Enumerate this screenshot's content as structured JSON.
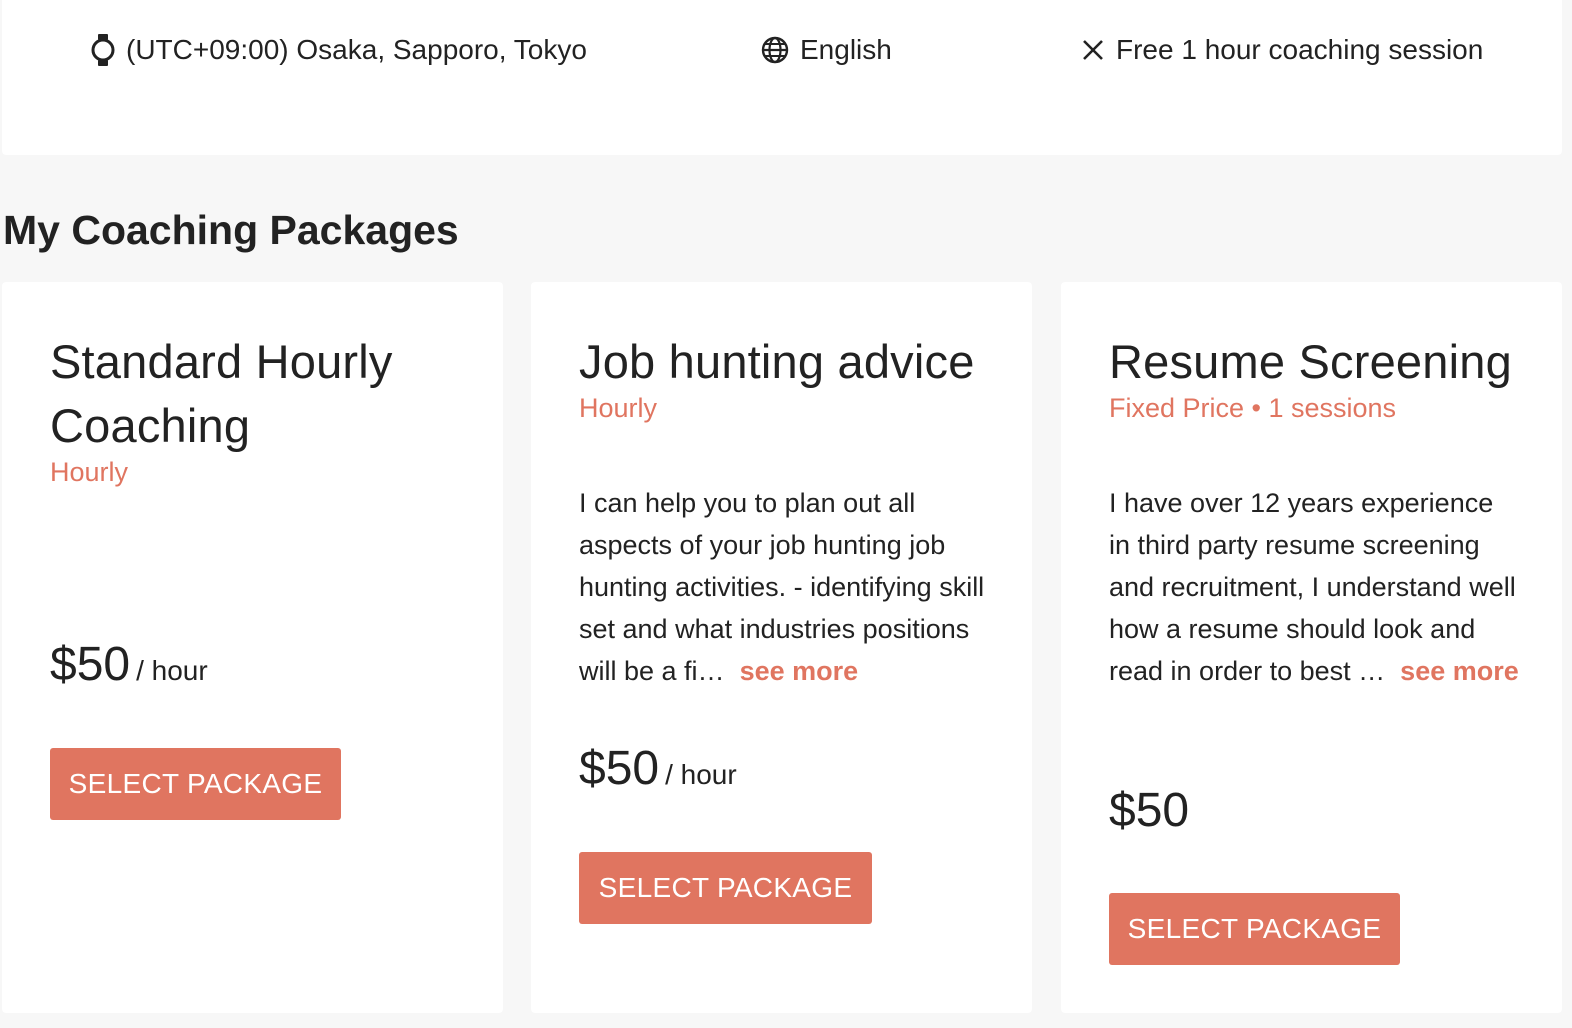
{
  "info_bar": {
    "timezone": "(UTC+09:00) Osaka, Sapporo, Tokyo",
    "timezone_icon": "watch-icon",
    "language": "English",
    "language_icon": "globe-icon",
    "free_session": "Free 1 hour coaching session",
    "free_session_icon": "close-icon"
  },
  "section": {
    "title": "My Coaching Packages"
  },
  "accent_color": "#e07560",
  "packages": [
    {
      "title": "Standard Hourly Coaching",
      "type": "Hourly",
      "description": "",
      "see_more": "",
      "price": "$50",
      "price_unit": "/ hour",
      "button": "SELECT PACKAGE"
    },
    {
      "title": "Job hunting advice",
      "type": "Hourly",
      "description": "I can help you to plan out all aspects of your job hunting job hunting activities. - identifying skill set and what industries positions will be a fi…",
      "see_more": "see more",
      "price": "$50",
      "price_unit": "/ hour",
      "button": "SELECT PACKAGE"
    },
    {
      "title": "Resume Screening",
      "type": "Fixed Price • 1 sessions",
      "description": "I have over 12 years experience in third party resume screening and recruitment, I understand well how a resume should look and read in order to best …",
      "see_more": "see more",
      "price": "$50",
      "price_unit": "",
      "button": "SELECT PACKAGE"
    }
  ]
}
